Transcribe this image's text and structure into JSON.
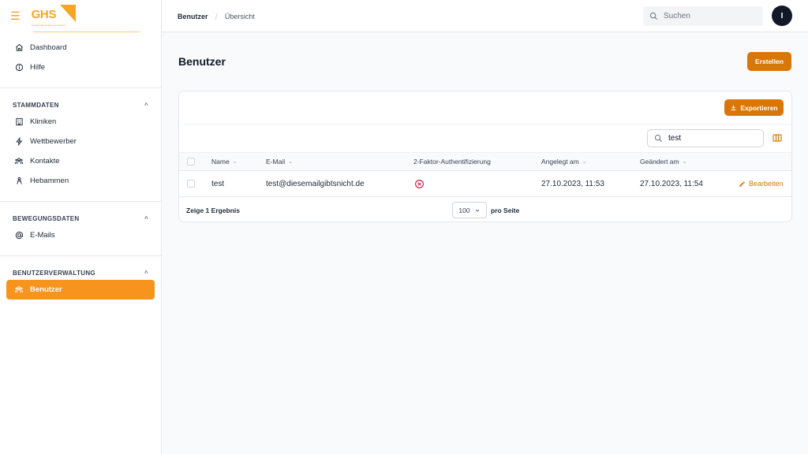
{
  "brand": {
    "name": "GHS",
    "tagline": "Gesellschaft Hebammen Service"
  },
  "breadcrumb": {
    "first": "Benutzer",
    "second": "Übersicht"
  },
  "header": {
    "search_placeholder": "Suchen",
    "avatar_initial": "I"
  },
  "sidebar": {
    "top_items": [
      {
        "label": "Dashboard",
        "icon": "home-icon"
      },
      {
        "label": "Hilfe",
        "icon": "info-icon"
      }
    ],
    "sections": [
      {
        "title": "STAMMDATEN",
        "items": [
          {
            "label": "Kliniken",
            "icon": "building-icon"
          },
          {
            "label": "Wettbewerber",
            "icon": "bolt-icon"
          },
          {
            "label": "Kontakte",
            "icon": "users-icon"
          },
          {
            "label": "Hebammen",
            "icon": "person-icon"
          }
        ]
      },
      {
        "title": "BEWEGUNGSDATEN",
        "items": [
          {
            "label": "E-Mails",
            "icon": "at-icon"
          }
        ]
      },
      {
        "title": "BENUTZERVERWALTUNG",
        "items": [
          {
            "label": "Benutzer",
            "icon": "users-icon",
            "active": true
          }
        ]
      }
    ]
  },
  "main": {
    "title": "Benutzer",
    "create_label": "Erstellen",
    "export_label": "Exportieren",
    "table_search_value": "test",
    "columns": {
      "name": "Name",
      "email": "E-Mail",
      "twofa": "2-Faktor-Authentifizierung",
      "created": "Angelegt am",
      "changed": "Geändert am"
    },
    "rows": [
      {
        "name": "test",
        "email": "test@diesemailgibtsnicht.de",
        "twofa": false,
        "created": "27.10.2023, 11:53",
        "changed": "27.10.2023, 11:54",
        "action": "Bearbeiten"
      }
    ],
    "results_text": "Zeige 1 Ergebnis",
    "per_page_value": "100",
    "per_page_label": "pro Seite"
  },
  "colors": {
    "accent": "#d97706",
    "active_nav": "#f7941d",
    "error": "#e11d48"
  }
}
